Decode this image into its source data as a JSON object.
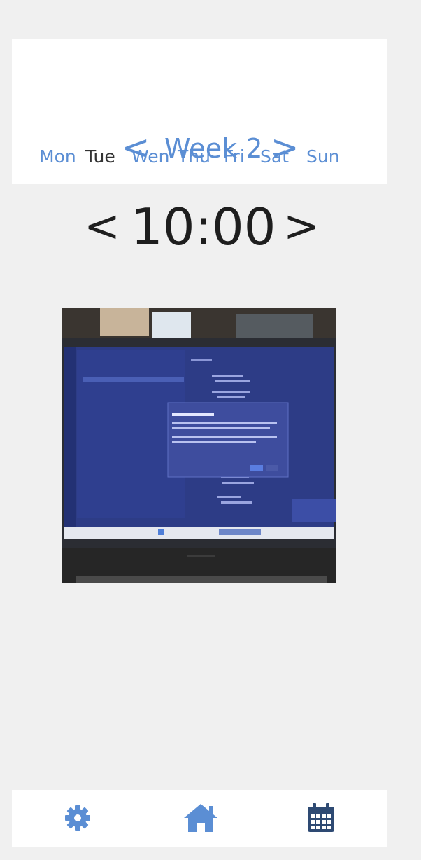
{
  "week": {
    "title": "Week 2",
    "prev_glyph": "<",
    "next_glyph": ">"
  },
  "days": [
    {
      "label": "Mon",
      "selected": false
    },
    {
      "label": "Tue",
      "selected": true
    },
    {
      "label": "Wen",
      "selected": false
    },
    {
      "label": "Thu",
      "selected": false
    },
    {
      "label": "Fri",
      "selected": false
    },
    {
      "label": "Sat",
      "selected": false
    },
    {
      "label": "Sun",
      "selected": false
    }
  ],
  "time": {
    "value": "10:00",
    "prev_glyph": "<",
    "next_glyph": ">"
  },
  "photo": {
    "alt": "laptop-screen-photo"
  },
  "bottom_nav": {
    "items": [
      {
        "name": "settings",
        "icon": "gear-icon"
      },
      {
        "name": "home",
        "icon": "home-icon"
      },
      {
        "name": "calendar",
        "icon": "calendar-icon"
      }
    ]
  },
  "colors": {
    "accent": "#5b8ed4",
    "text_dark": "#1e1e1e",
    "background": "#f0f0f0",
    "card": "#ffffff",
    "icon_dark": "#2e4a73"
  }
}
